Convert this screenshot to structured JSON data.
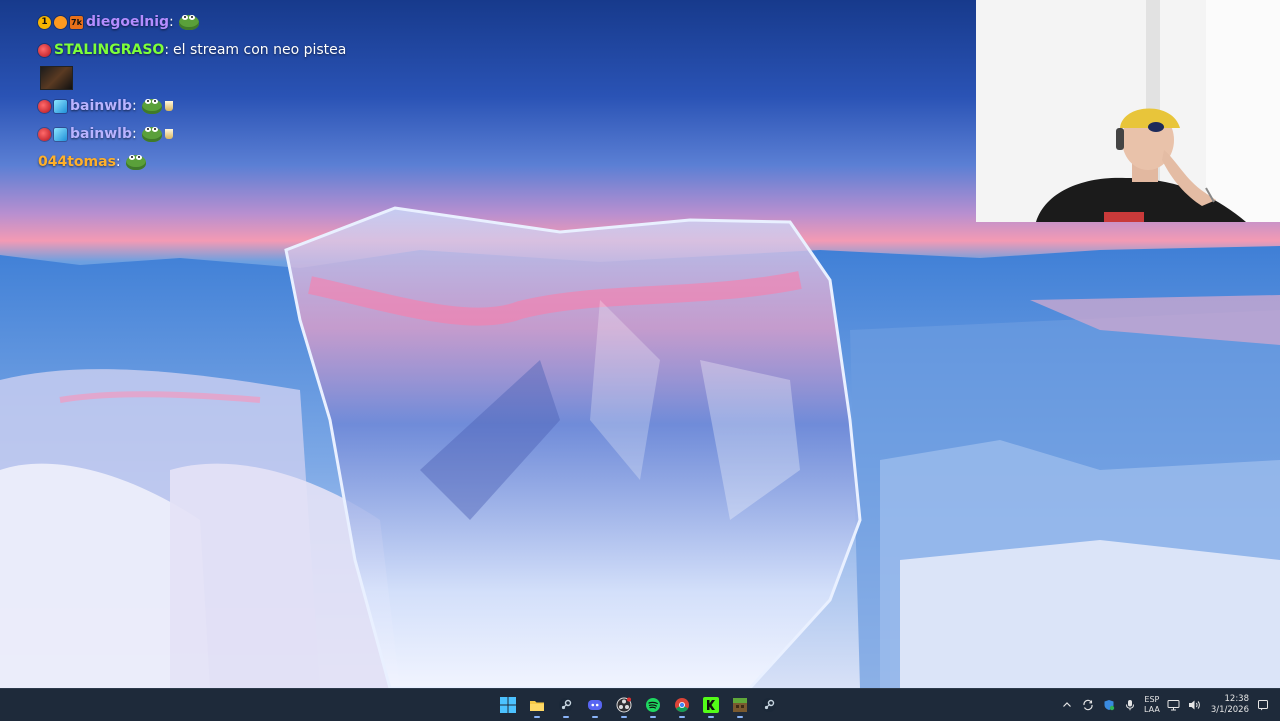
{
  "chat": {
    "messages": [
      {
        "user": "diegoelnig",
        "user_color": "#b48dff",
        "badges": [
          "1",
          "orange-circle",
          "7k"
        ],
        "text": "",
        "emotes": [
          "frog-emote"
        ]
      },
      {
        "user": "STALINGRASO",
        "user_color": "#7dff3a",
        "badges": [
          "red-circle"
        ],
        "text": "el stream con neo pistea",
        "emotes": []
      },
      {
        "user": "",
        "badges": [],
        "text": "",
        "emotes": [
          "image-thumbnail"
        ]
      },
      {
        "user": "bainwlb",
        "user_color": "#b9b3ff",
        "badges": [
          "red-circle",
          "blue-cube"
        ],
        "text": "",
        "emotes": [
          "frog-emote",
          "cup-emote"
        ]
      },
      {
        "user": "bainwlb",
        "user_color": "#b9b3ff",
        "badges": [
          "red-circle",
          "blue-cube"
        ],
        "text": "",
        "emotes": [
          "frog-emote",
          "cup-emote"
        ]
      },
      {
        "user": "044tomas",
        "user_color": "#ffb02a",
        "badges": [],
        "text": "",
        "emotes": [
          "frog-emote"
        ]
      }
    ],
    "separator": ":"
  },
  "badges": {
    "num_1": "1",
    "sq_7k": "7k"
  },
  "taskbar": {
    "apps": [
      {
        "name": "windows-start-icon"
      },
      {
        "name": "file-explorer-icon"
      },
      {
        "name": "steam-icon"
      },
      {
        "name": "discord-icon"
      },
      {
        "name": "obs-icon"
      },
      {
        "name": "spotify-icon"
      },
      {
        "name": "chrome-icon"
      },
      {
        "name": "kick-icon"
      },
      {
        "name": "minecraft-icon"
      },
      {
        "name": "steam-icon-2"
      }
    ],
    "tray": {
      "language_top": "ESP",
      "language_bottom": "LAA",
      "time": "12:38",
      "date": "3/1/2026"
    }
  },
  "colors": {
    "taskbar_bg": "#1e2a3a",
    "accent": "#8ab4f8"
  }
}
